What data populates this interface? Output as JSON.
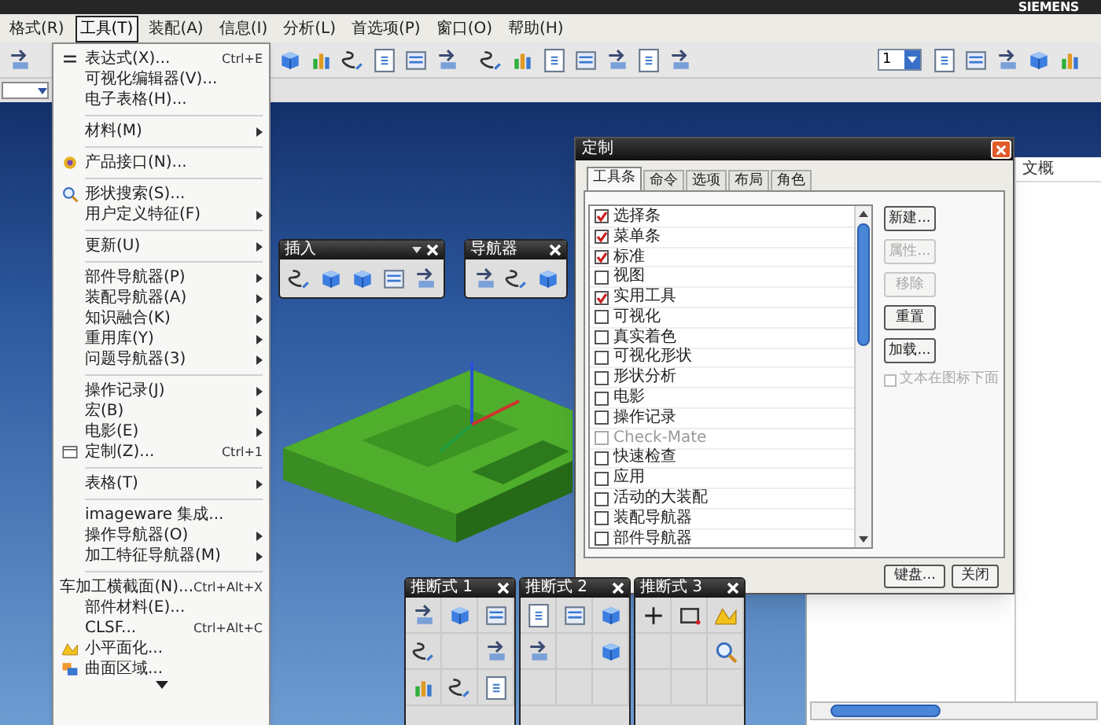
{
  "window": {
    "brand": "SIEMENS"
  },
  "menu_bar": [
    {
      "label": "格式(R)",
      "selected": false
    },
    {
      "label": "工具(T)",
      "selected": true
    },
    {
      "label": "装配(A)",
      "selected": false
    },
    {
      "label": "信息(I)",
      "selected": false
    },
    {
      "label": "分析(L)",
      "selected": false
    },
    {
      "label": "首选项(P)",
      "selected": false
    },
    {
      "label": "窗口(O)",
      "selected": false
    },
    {
      "label": "帮助(H)",
      "selected": false
    }
  ],
  "toolbar": {
    "layer_value": "1"
  },
  "tools_menu": [
    {
      "kind": "item",
      "label": "表达式(X)...",
      "shortcut": "Ctrl+E",
      "submenu": false
    },
    {
      "kind": "item",
      "label": "可视化编辑器(V)...",
      "submenu": false
    },
    {
      "kind": "item",
      "label": "电子表格(H)...",
      "submenu": false
    },
    {
      "kind": "separator"
    },
    {
      "kind": "item",
      "label": "材料(M)",
      "submenu": true
    },
    {
      "kind": "separator"
    },
    {
      "kind": "item",
      "label": "产品接口(N)...",
      "submenu": false
    },
    {
      "kind": "separator"
    },
    {
      "kind": "item",
      "label": "形状搜索(S)...",
      "submenu": false
    },
    {
      "kind": "item",
      "label": "用户定义特征(F)",
      "submenu": true
    },
    {
      "kind": "separator"
    },
    {
      "kind": "item",
      "label": "更新(U)",
      "submenu": true
    },
    {
      "kind": "separator"
    },
    {
      "kind": "item",
      "label": "部件导航器(P)",
      "submenu": true
    },
    {
      "kind": "item",
      "label": "装配导航器(A)",
      "submenu": true
    },
    {
      "kind": "item",
      "label": "知识融合(K)",
      "submenu": true
    },
    {
      "kind": "item",
      "label": "重用库(Y)",
      "submenu": true
    },
    {
      "kind": "item",
      "label": "问题导航器(3)",
      "submenu": true
    },
    {
      "kind": "separator"
    },
    {
      "kind": "item",
      "label": "操作记录(J)",
      "submenu": true
    },
    {
      "kind": "item",
      "label": "宏(B)",
      "submenu": true
    },
    {
      "kind": "item",
      "label": "电影(E)",
      "submenu": true
    },
    {
      "kind": "item",
      "label": "定制(Z)...",
      "shortcut": "Ctrl+1",
      "submenu": false
    },
    {
      "kind": "separator"
    },
    {
      "kind": "item",
      "label": "表格(T)",
      "submenu": true
    },
    {
      "kind": "separator"
    },
    {
      "kind": "item",
      "label": "imageware 集成...",
      "submenu": false
    },
    {
      "kind": "item",
      "label": "操作导航器(O)",
      "submenu": true
    },
    {
      "kind": "item",
      "label": "加工特征导航器(M)",
      "submenu": true
    },
    {
      "kind": "separator"
    },
    {
      "kind": "item",
      "label": "车加工横截面(N)...",
      "shortcut": "Ctrl+Alt+X",
      "submenu": false
    },
    {
      "kind": "item",
      "label": "部件材料(E)...",
      "submenu": false
    },
    {
      "kind": "item",
      "label": "CLSF...",
      "shortcut": "Ctrl+Alt+C",
      "submenu": false
    },
    {
      "kind": "item",
      "label": "小平面化...",
      "submenu": false
    },
    {
      "kind": "item",
      "label": "曲面区域...",
      "submenu": false
    }
  ],
  "insert_toolbar": {
    "title": "插入"
  },
  "navigator_toolbar": {
    "title": "导航器"
  },
  "inferred_toolbars": [
    {
      "title": "推断式 1"
    },
    {
      "title": "推断式 2"
    },
    {
      "title": "推断式 3"
    }
  ],
  "customize_dialog": {
    "title": "定制",
    "tabs": [
      {
        "label": "工具条",
        "selected": true
      },
      {
        "label": "命令",
        "selected": false
      },
      {
        "label": "选项",
        "selected": false
      },
      {
        "label": "布局",
        "selected": false
      },
      {
        "label": "角色",
        "selected": false
      }
    ],
    "toolbar_list": [
      {
        "label": "选择条",
        "checked": true,
        "disabled": false
      },
      {
        "label": "菜单条",
        "checked": true,
        "disabled": false
      },
      {
        "label": "标准",
        "checked": true,
        "disabled": false
      },
      {
        "label": "视图",
        "checked": false,
        "disabled": false
      },
      {
        "label": "实用工具",
        "checked": true,
        "disabled": false
      },
      {
        "label": "可视化",
        "checked": false,
        "disabled": false
      },
      {
        "label": "真实着色",
        "checked": false,
        "disabled": false
      },
      {
        "label": "可视化形状",
        "checked": false,
        "disabled": false
      },
      {
        "label": "形状分析",
        "checked": false,
        "disabled": false
      },
      {
        "label": "电影",
        "checked": false,
        "disabled": false
      },
      {
        "label": "操作记录",
        "checked": false,
        "disabled": false
      },
      {
        "label": "Check-Mate",
        "checked": false,
        "disabled": true
      },
      {
        "label": "快速检查",
        "checked": false,
        "disabled": false
      },
      {
        "label": "应用",
        "checked": false,
        "disabled": false
      },
      {
        "label": "活动的大装配",
        "checked": false,
        "disabled": false
      },
      {
        "label": "装配导航器",
        "checked": false,
        "disabled": false
      },
      {
        "label": "部件导航器",
        "checked": false,
        "disabled": false
      }
    ],
    "side_buttons": [
      {
        "label": "新建...",
        "disabled": false
      },
      {
        "label": "属性...",
        "disabled": true
      },
      {
        "label": "移除",
        "disabled": true
      },
      {
        "label": "重置",
        "disabled": false
      },
      {
        "label": "加载...",
        "disabled": false
      }
    ],
    "text_below_icons": {
      "label": "文本在图标下面",
      "checked": false,
      "disabled": true
    },
    "footer_buttons": [
      {
        "label": "键盘..."
      },
      {
        "label": "关闭"
      }
    ]
  },
  "right_panel": {
    "column_1": "文概"
  }
}
